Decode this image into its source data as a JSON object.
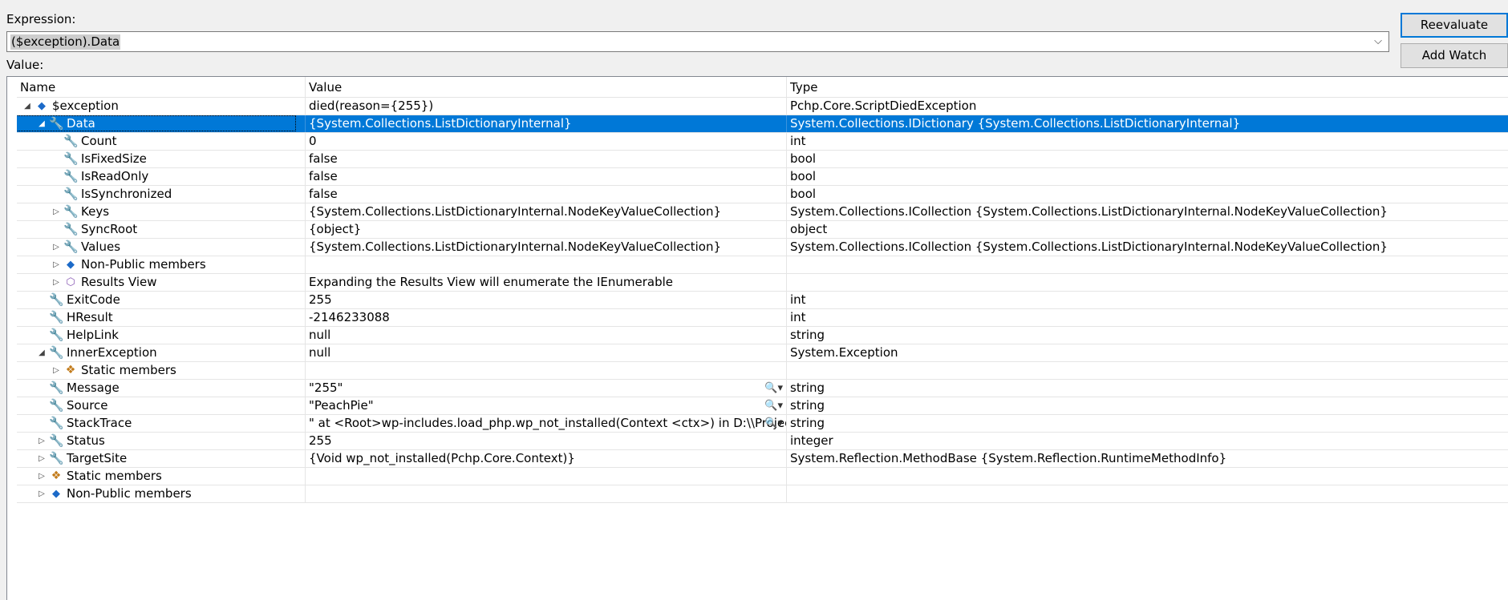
{
  "expression": {
    "label": "Expression:",
    "value": "($exception).Data",
    "dropdown_icon": "chevron-down-icon"
  },
  "buttons": {
    "reevaluate": "Reevaluate",
    "add_watch": "Add Watch"
  },
  "value_label": "Value:",
  "grid": {
    "columns": [
      "Name",
      "Value",
      "Type"
    ],
    "rows": [
      {
        "depth": 0,
        "expander": "expanded",
        "icon": "object-icon",
        "name": "$exception",
        "value": "died(reason={255})",
        "type": "Pchp.Core.ScriptDiedException"
      },
      {
        "depth": 1,
        "expander": "expanded",
        "icon": "wrench-icon",
        "name": "Data",
        "value": "{System.Collections.ListDictionaryInternal}",
        "type": "System.Collections.IDictionary {System.Collections.ListDictionaryInternal}",
        "selected": true
      },
      {
        "depth": 2,
        "expander": "none",
        "icon": "wrench-icon",
        "name": "Count",
        "value": "0",
        "type": "int"
      },
      {
        "depth": 2,
        "expander": "none",
        "icon": "wrench-icon",
        "name": "IsFixedSize",
        "value": "false",
        "type": "bool"
      },
      {
        "depth": 2,
        "expander": "none",
        "icon": "wrench-icon",
        "name": "IsReadOnly",
        "value": "false",
        "type": "bool"
      },
      {
        "depth": 2,
        "expander": "none",
        "icon": "wrench-icon",
        "name": "IsSynchronized",
        "value": "false",
        "type": "bool"
      },
      {
        "depth": 2,
        "expander": "collapsed",
        "icon": "wrench-icon",
        "name": "Keys",
        "value": "{System.Collections.ListDictionaryInternal.NodeKeyValueCollection}",
        "type": "System.Collections.ICollection {System.Collections.ListDictionaryInternal.NodeKeyValueCollection}"
      },
      {
        "depth": 2,
        "expander": "none",
        "icon": "wrench-icon",
        "name": "SyncRoot",
        "value": "{object}",
        "type": "object"
      },
      {
        "depth": 2,
        "expander": "collapsed",
        "icon": "wrench-icon",
        "name": "Values",
        "value": "{System.Collections.ListDictionaryInternal.NodeKeyValueCollection}",
        "type": "System.Collections.ICollection {System.Collections.ListDictionaryInternal.NodeKeyValueCollection}"
      },
      {
        "depth": 2,
        "expander": "collapsed",
        "icon": "object-icon",
        "name": "Non-Public members",
        "value": "",
        "type": ""
      },
      {
        "depth": 2,
        "expander": "collapsed",
        "icon": "results-view-icon",
        "name": "Results View",
        "value": "Expanding the Results View will enumerate the IEnumerable",
        "type": ""
      },
      {
        "depth": 1,
        "expander": "none",
        "icon": "wrench-icon",
        "name": "ExitCode",
        "value": "255",
        "type": "int"
      },
      {
        "depth": 1,
        "expander": "none",
        "icon": "wrench-icon",
        "name": "HResult",
        "value": "-2146233088",
        "type": "int"
      },
      {
        "depth": 1,
        "expander": "none",
        "icon": "wrench-icon",
        "name": "HelpLink",
        "value": "null",
        "type": "string"
      },
      {
        "depth": 1,
        "expander": "expanded",
        "icon": "wrench-icon",
        "name": "InnerException",
        "value": "null",
        "type": "System.Exception"
      },
      {
        "depth": 2,
        "expander": "collapsed",
        "icon": "static-members-icon",
        "name": "Static members",
        "value": "",
        "type": ""
      },
      {
        "depth": 1,
        "expander": "none",
        "icon": "wrench-icon",
        "name": "Message",
        "value": "\"255\"",
        "type": "string",
        "visualizer": true
      },
      {
        "depth": 1,
        "expander": "none",
        "icon": "wrench-icon",
        "name": "Source",
        "value": "\"PeachPie\"",
        "type": "string",
        "visualizer": true
      },
      {
        "depth": 1,
        "expander": "none",
        "icon": "wrench-icon",
        "name": "StackTrace",
        "value": "\"   at <Root>wp-includes.load_php.wp_not_installed(Context <ctx>) in D:\\\\Projects\\\\",
        "type": "string",
        "visualizer": true
      },
      {
        "depth": 1,
        "expander": "collapsed",
        "icon": "wrench-icon",
        "name": "Status",
        "value": "255",
        "type": "integer"
      },
      {
        "depth": 1,
        "expander": "collapsed",
        "icon": "wrench-icon",
        "name": "TargetSite",
        "value": "{Void wp_not_installed(Pchp.Core.Context)}",
        "type": "System.Reflection.MethodBase {System.Reflection.RuntimeMethodInfo}"
      },
      {
        "depth": 1,
        "expander": "collapsed",
        "icon": "static-members-icon",
        "name": "Static members",
        "value": "",
        "type": ""
      },
      {
        "depth": 1,
        "expander": "collapsed",
        "icon": "object-icon",
        "name": "Non-Public members",
        "value": "",
        "type": ""
      }
    ]
  }
}
